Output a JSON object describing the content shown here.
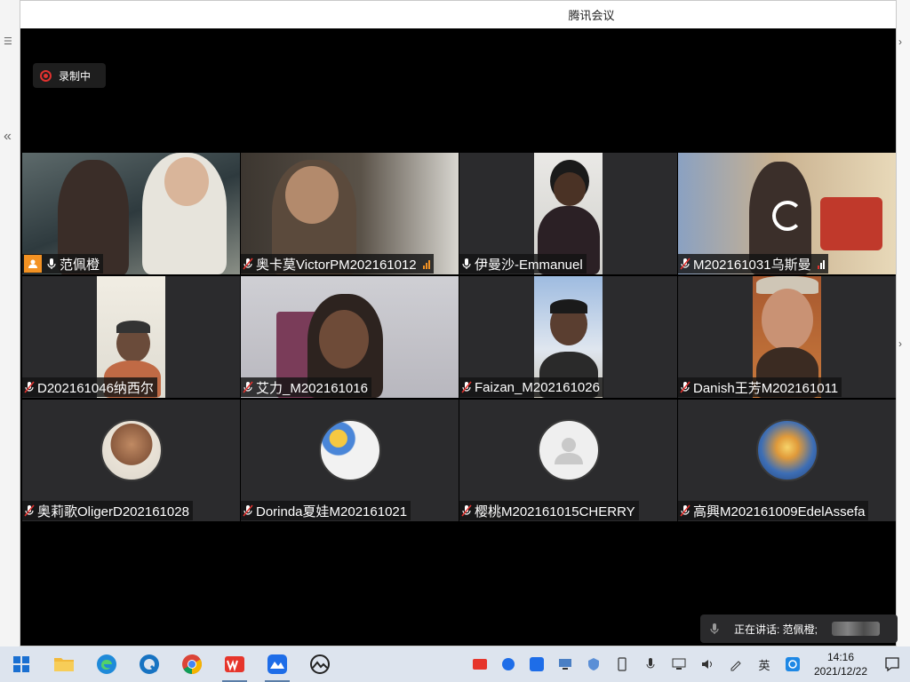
{
  "window": {
    "title": "腾讯会议"
  },
  "recording": {
    "label": "录制中"
  },
  "participants": [
    {
      "name": "范佩橙",
      "host": true,
      "muted": false,
      "active": true,
      "signal": false
    },
    {
      "name": "奥卡莫VictorPM202161012",
      "host": false,
      "muted": true,
      "active": false,
      "signal": true
    },
    {
      "name": "伊曼沙-Emmanuel",
      "host": false,
      "muted": false,
      "active": false,
      "signal": false
    },
    {
      "name": "M202161031乌斯曼",
      "host": false,
      "muted": true,
      "active": false,
      "signal": true
    },
    {
      "name": "D202161046纳西尔",
      "host": false,
      "muted": true,
      "active": false,
      "signal": false
    },
    {
      "name": "艾力_M202161016",
      "host": false,
      "muted": true,
      "active": false,
      "signal": false
    },
    {
      "name": "Faizan_M202161026",
      "host": false,
      "muted": true,
      "active": false,
      "signal": false
    },
    {
      "name": "Danish王芳M202161011",
      "host": false,
      "muted": true,
      "active": false,
      "signal": false
    },
    {
      "name": "奥莉歌OligerD202161028",
      "host": false,
      "muted": true,
      "active": false,
      "signal": false
    },
    {
      "name": "Dorinda夏娃M202161021",
      "host": false,
      "muted": true,
      "active": false,
      "signal": false
    },
    {
      "name": "樱桃M202161015CHERRY",
      "host": false,
      "muted": true,
      "active": false,
      "signal": false
    },
    {
      "name": "高興M202161009EdelAssefa",
      "host": false,
      "muted": true,
      "active": false,
      "signal": false
    }
  ],
  "speaking": {
    "label": "正在讲话: 范佩橙;"
  },
  "taskbar": {
    "apps": [
      "windows-start-icon",
      "file-explorer-icon",
      "edge-icon",
      "edge-beta-icon",
      "chrome-icon",
      "wps-icon",
      "tencent-meeting-icon",
      "photos-icon"
    ],
    "tray_ime": "英",
    "time": "14:16",
    "date": "2021/12/22"
  },
  "colors": {
    "active_border": "#39a855",
    "host_badge": "#f39223",
    "muted_red": "#e0322f",
    "taskbar": "#dde4ee"
  }
}
